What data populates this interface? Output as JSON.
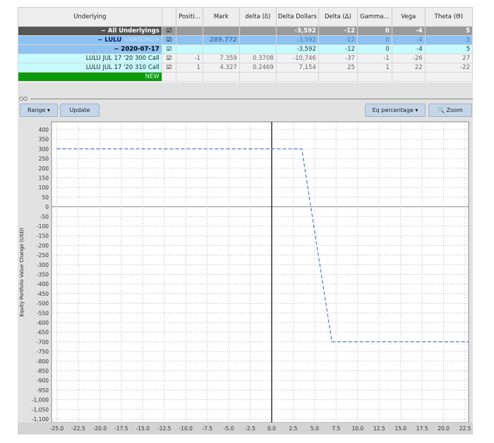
{
  "table": {
    "headers": [
      "Underlying",
      "",
      "Positi...",
      "Mark",
      "delta (δ)",
      "Delta Dollars",
      "Delta (Δ)",
      "Gamma...",
      "Vega",
      "Theta (Θ)"
    ],
    "rows": [
      {
        "name": "− All Underlyings",
        "check": "☑",
        "pos": "",
        "mark": "",
        "delta": "",
        "dd": "-3,592",
        "D": "-12",
        "gamma": "0",
        "vega": "-4",
        "theta": "5"
      },
      {
        "name": "− LULU",
        "exchange": "<NASDAQ>",
        "check": "☑",
        "pos": "",
        "mark": "289.772",
        "delta": "",
        "dd": "-3,592",
        "D": "-12",
        "gamma": "0",
        "vega": "-4",
        "theta": "5"
      },
      {
        "name": "− 2020-07-17",
        "check": "☑",
        "pos": "",
        "mark": "",
        "delta": "",
        "dd": "-3,592",
        "D": "-12",
        "gamma": "0",
        "vega": "-4",
        "theta": "5"
      },
      {
        "name": "LULU JUL 17 '20 300 Call",
        "check": "☑",
        "pos": "-1",
        "mark": "7.359",
        "delta": "0.3708",
        "dd": "-10,746",
        "D": "-37",
        "gamma": "-1",
        "vega": "-26",
        "theta": "27"
      },
      {
        "name": "LULU JUL 17 '20 310 Call",
        "check": "☑",
        "pos": "1",
        "mark": "4.327",
        "delta": "0.2469",
        "dd": "7,154",
        "D": "25",
        "gamma": "1",
        "vega": "22",
        "theta": "-22"
      },
      {
        "name": "NEW"
      }
    ]
  },
  "toolbar": {
    "range": "Range ▾",
    "update": "Update",
    "eq": "Eq percentage ▾",
    "zoom": "Zoom"
  },
  "chart_data": {
    "type": "line",
    "ylabel": "Equity Portfolio Value Change (USD)",
    "xlabel": "",
    "xlim": [
      -25,
      22.5
    ],
    "ylim": [
      -1100,
      400
    ],
    "xticks": [
      -25,
      -22.5,
      -20,
      -17.5,
      -15,
      -12.5,
      -10,
      -7.5,
      -5,
      -2.5,
      0,
      2.5,
      5,
      7.5,
      10,
      12.5,
      15,
      17.5,
      20,
      22.5
    ],
    "yticks": [
      400,
      350,
      300,
      250,
      200,
      150,
      100,
      50,
      0,
      -50,
      -100,
      -150,
      -200,
      -250,
      -300,
      -350,
      -400,
      -450,
      -500,
      -550,
      -600,
      -650,
      -700,
      -750,
      -800,
      -850,
      -900,
      -950,
      -1000,
      -1050,
      -1100
    ],
    "grid": true,
    "series": [
      {
        "x": [
          -25,
          3.5,
          7,
          23
        ],
        "y": [
          300,
          300,
          -700,
          -700
        ],
        "color": "#5577cc",
        "style": "dashed"
      }
    ]
  }
}
